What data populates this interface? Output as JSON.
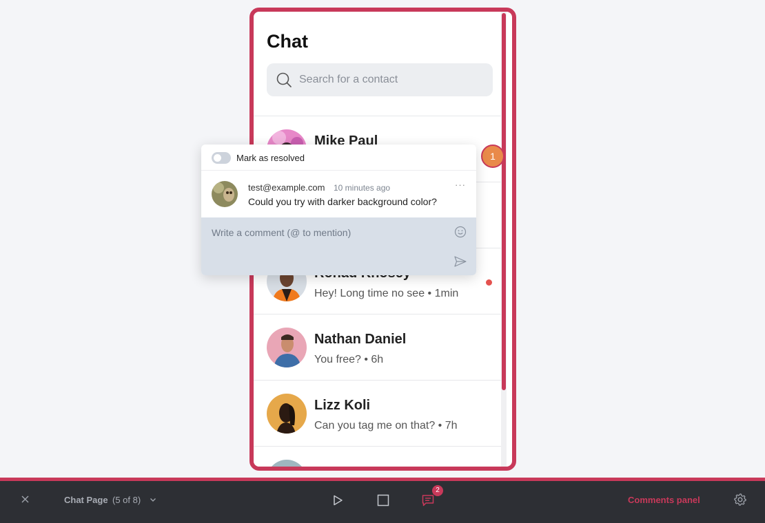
{
  "chat": {
    "title": "Chat",
    "search_placeholder": "Search for a contact",
    "contacts": [
      {
        "name": "Mike Paul",
        "message": "",
        "unread": false
      },
      {
        "name": "",
        "message": "",
        "unread": false
      },
      {
        "name": "Rohad Khosey",
        "message": "Hey! Long time no see • 1min",
        "unread": true
      },
      {
        "name": "Nathan Daniel",
        "message": "You free? • 6h",
        "unread": false
      },
      {
        "name": "Lizz Koli",
        "message": "Can you tag me on that? • 7h",
        "unread": false
      }
    ]
  },
  "comment_marker": {
    "count": "1"
  },
  "comment_popup": {
    "resolved_label": "Mark as resolved",
    "author": "test@example.com",
    "time": "10 minutes ago",
    "more": "···",
    "text": "Could you try with darker background color?",
    "reply_placeholder": "Write a comment (@ to mention)"
  },
  "toolbar": {
    "page_name": "Chat Page",
    "page_count": "(5 of 8)",
    "comments_badge": "2",
    "comments_panel_label": "Comments panel"
  },
  "colors": {
    "accent": "#c8395a",
    "toolbar_bg": "#2d2f34",
    "marker": "#e98a4a"
  }
}
